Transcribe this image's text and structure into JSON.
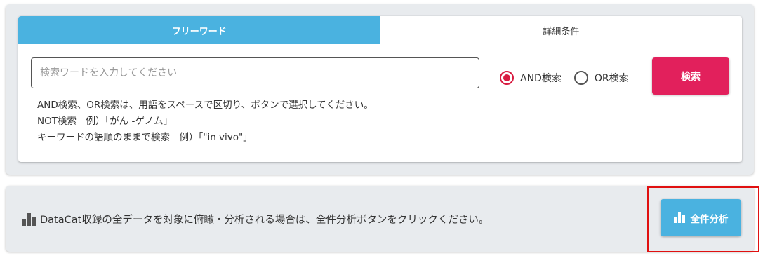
{
  "tabs": [
    {
      "label": "フリーワード",
      "active": true
    },
    {
      "label": "詳細条件",
      "active": false
    }
  ],
  "search": {
    "placeholder": "検索ワードを入力してください",
    "value": ""
  },
  "radio": {
    "and_label": "AND検索",
    "or_label": "OR検索",
    "selected": "AND"
  },
  "search_button_label": "検索",
  "help": {
    "line1": "AND検索、OR検索は、用語をスペースで区切り、ボタンで選択してください。",
    "line2": "NOT検索　例）「がん -ゲノム」",
    "line3": "キーワードの語順のままで検索　例）「\"in vivo\"」"
  },
  "analysis": {
    "message": "DataCat収録の全データを対象に俯瞰・分析される場合は、全件分析ボタンをクリックください。",
    "button_label": "全件分析",
    "icon": "bar-chart-icon"
  },
  "colors": {
    "tab_active": "#4ab2e0",
    "search_button": "#e2205c",
    "analyze_button": "#4ab2e0",
    "radio_checked": "#d81b40",
    "highlight": "#e01010"
  }
}
